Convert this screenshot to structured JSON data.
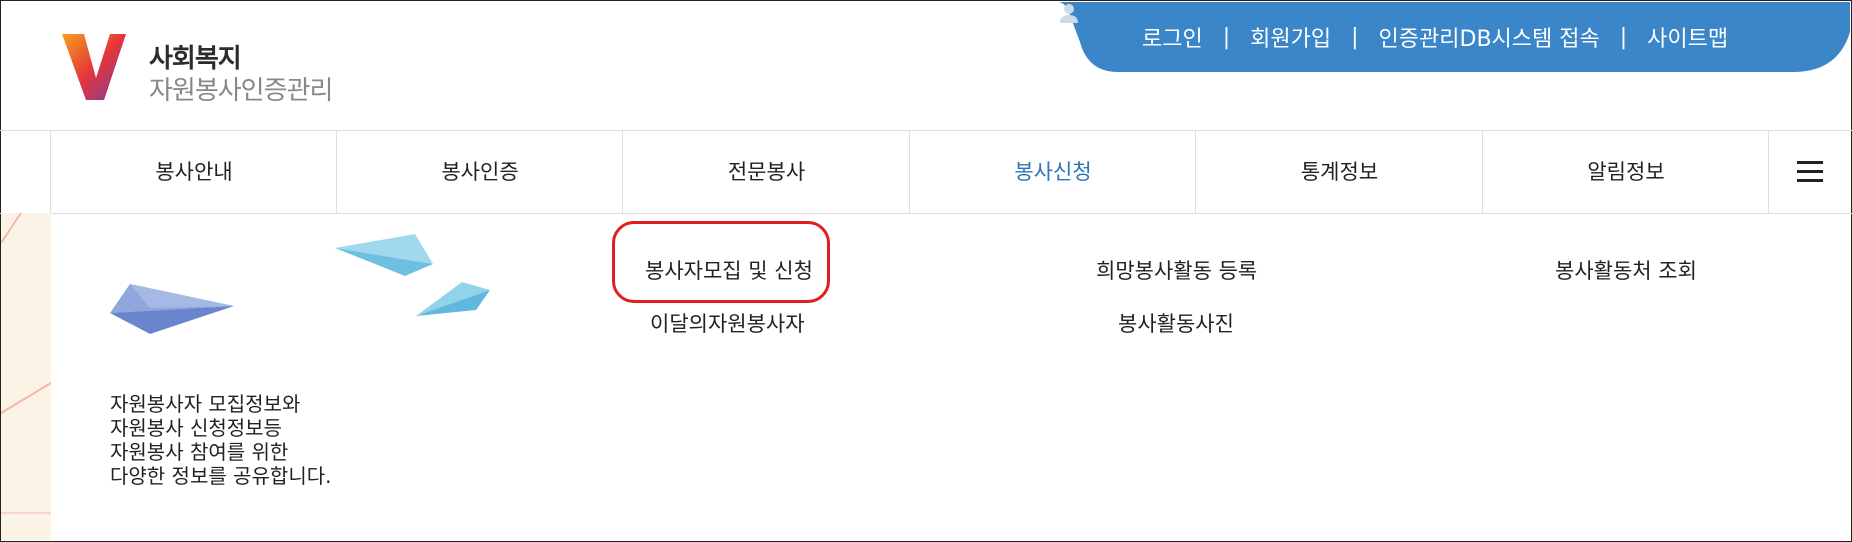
{
  "brand": {
    "line1": "사회복지",
    "line2": "자원봉사인증관리"
  },
  "util_nav": {
    "login": "로그인",
    "join": "회원가입",
    "db": "인증관리DB시스템 접속",
    "sitemap": "사이트맵",
    "separator": "|"
  },
  "nav": {
    "items": [
      {
        "label": "봉사안내"
      },
      {
        "label": "봉사인증"
      },
      {
        "label": "전문봉사"
      },
      {
        "label": "봉사신청",
        "active": true
      },
      {
        "label": "통계정보"
      },
      {
        "label": "알림정보"
      }
    ]
  },
  "submenu": {
    "items": [
      "봉사자모집 및 신청",
      "희망봉사활동 등록",
      "봉사활동처 조회",
      "이달의자원봉사자",
      "봉사활동사진"
    ]
  },
  "description": {
    "lines": [
      "자원봉사자 모집정보와",
      "자원봉사 신청정보등",
      "자원봉사 참여를 위한",
      "다양한 정보를 공유합니다."
    ]
  },
  "colors": {
    "accent": "#3a86c8",
    "active_nav": "#2e74b5",
    "highlight": "#e02020"
  }
}
